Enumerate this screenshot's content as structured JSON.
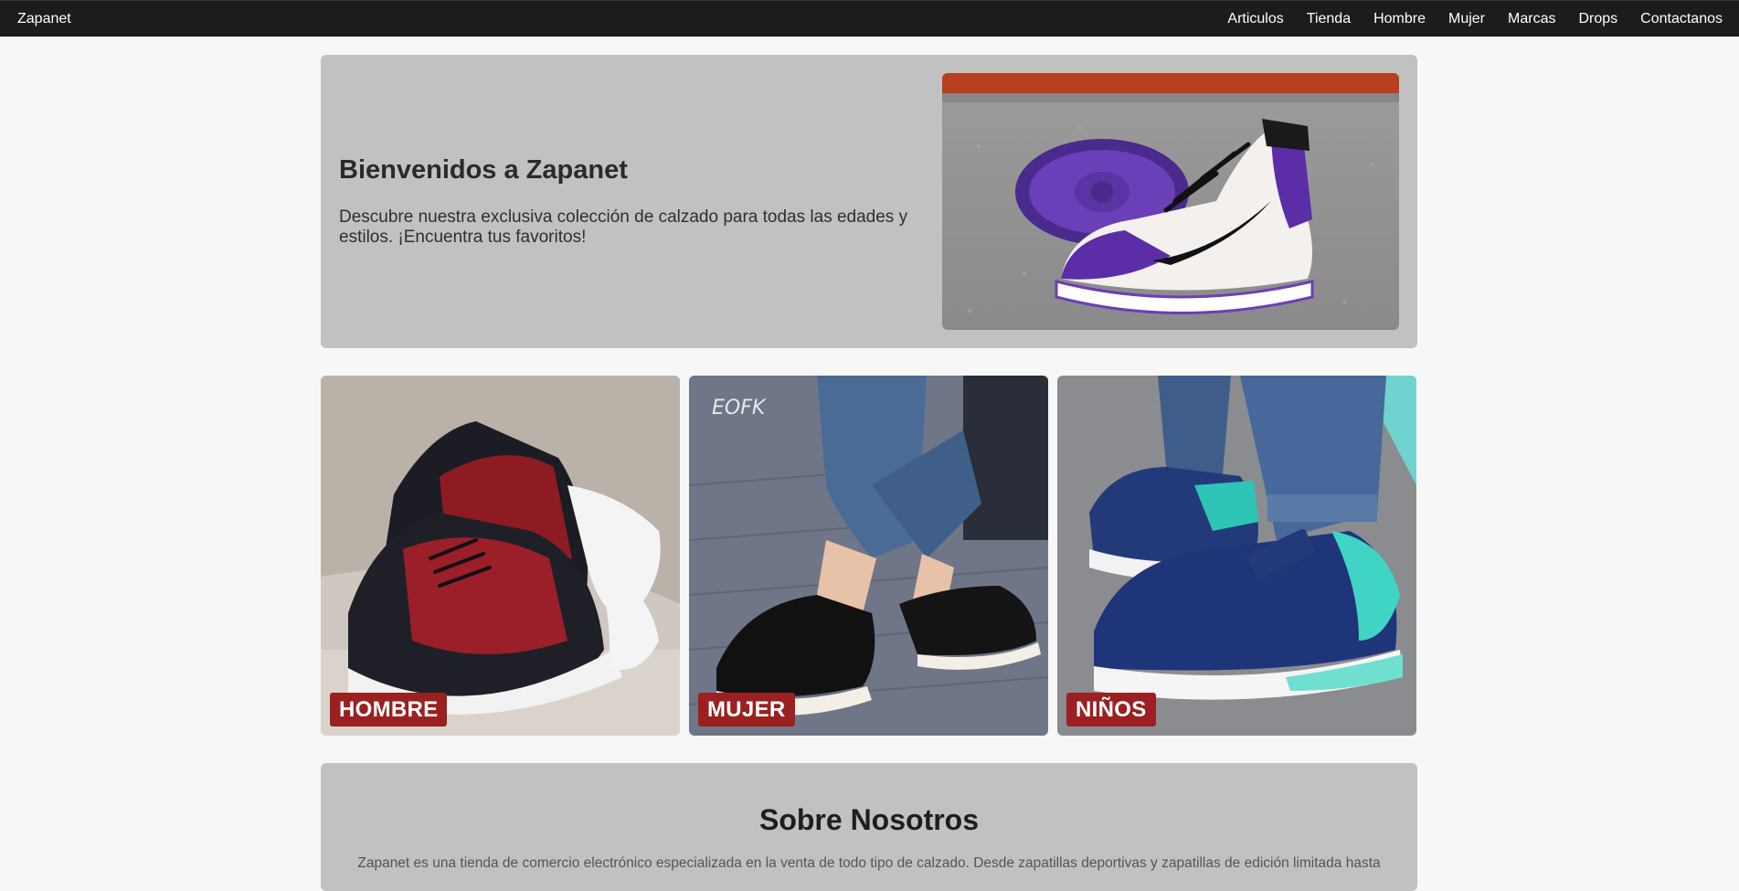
{
  "navbar": {
    "brand": "Zapanet",
    "links": [
      {
        "label": "Articulos"
      },
      {
        "label": "Tienda"
      },
      {
        "label": "Hombre"
      },
      {
        "label": "Mujer"
      },
      {
        "label": "Marcas"
      },
      {
        "label": "Drops"
      },
      {
        "label": "Contactanos"
      }
    ]
  },
  "hero": {
    "title": "Bienvenidos a Zapanet",
    "description": "Descubre nuestra exclusiva colección de calzado para todas las edades y estilos. ¡Encuentra tus favoritos!",
    "image_alt": "purple-high-top-sneaker"
  },
  "categories": [
    {
      "label": "HOMBRE",
      "image": "black-red-running-sneakers"
    },
    {
      "label": "MUJER",
      "image": "black-patent-platform-oxfords",
      "watermark": "EOFK"
    },
    {
      "label": "NIÑOS",
      "image": "navy-teal-kids-sneakers"
    }
  ],
  "about": {
    "title": "Sobre Nosotros",
    "text": "Zapanet es una tienda de comercio electrónico especializada en la venta de todo tipo de calzado. Desde zapatillas deportivas y zapatillas de edición limitada hasta"
  },
  "colors": {
    "navbar_bg": "#1c1c1c",
    "page_bg": "#f7f7f7",
    "panel_bg": "#c1c1c1",
    "label_bg": "#9b2020",
    "text_dark": "#2a2a2a"
  }
}
